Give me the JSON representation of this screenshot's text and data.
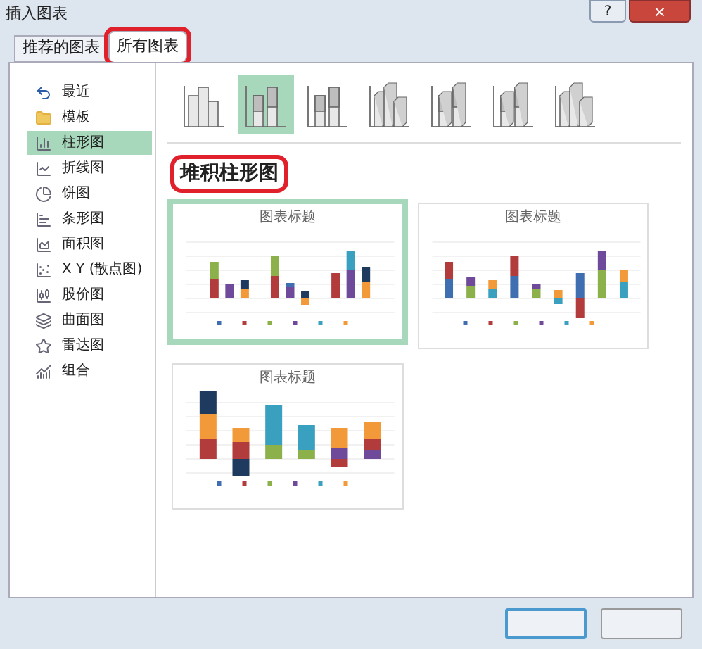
{
  "window": {
    "title": "插入图表",
    "help": "?",
    "close": "×"
  },
  "tabs": [
    {
      "label": "推荐的图表",
      "selected": false,
      "circled": false
    },
    {
      "label": "所有图表",
      "selected": true,
      "circled": true
    }
  ],
  "sidebar": {
    "items": [
      {
        "label": "最近",
        "selected": false
      },
      {
        "label": "模板",
        "selected": false
      },
      {
        "label": "柱形图",
        "selected": true
      },
      {
        "label": "折线图",
        "selected": false
      },
      {
        "label": "饼图",
        "selected": false
      },
      {
        "label": "条形图",
        "selected": false
      },
      {
        "label": "面积图",
        "selected": false
      },
      {
        "label": "X Y (散点图)",
        "selected": false
      },
      {
        "label": "股价图",
        "selected": false
      },
      {
        "label": "曲面图",
        "selected": false
      },
      {
        "label": "雷达图",
        "selected": false
      },
      {
        "label": "组合",
        "selected": false
      }
    ]
  },
  "subtypes": [
    {
      "selected": false
    },
    {
      "selected": true
    },
    {
      "selected": false
    },
    {
      "selected": false
    },
    {
      "selected": false
    },
    {
      "selected": false
    },
    {
      "selected": false
    }
  ],
  "subtype_title": {
    "text": "堆积柱形图",
    "circled": true
  },
  "previews": [
    {
      "title": "图表标题",
      "selected": true
    },
    {
      "title": "图表标题",
      "selected": false
    },
    {
      "title": "图表标题",
      "selected": false
    }
  ]
}
